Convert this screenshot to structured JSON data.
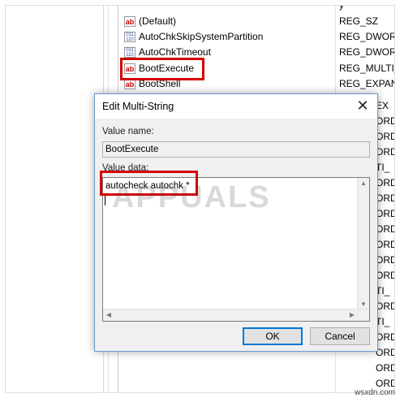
{
  "registry": {
    "header_fragment": "y",
    "rows": [
      {
        "name": "(Default)",
        "type": "REG_SZ",
        "icon": "string-value-icon"
      },
      {
        "name": "AutoChkSkipSystemPartition",
        "type": "REG_DWORD",
        "icon": "binary-value-icon"
      },
      {
        "name": "AutoChkTimeout",
        "type": "REG_DWORD",
        "icon": "binary-value-icon"
      },
      {
        "name": "BootExecute",
        "type": "REG_MULTI_",
        "icon": "string-value-icon"
      },
      {
        "name": "BootShell",
        "type": "REG_EXPANI",
        "icon": "string-value-icon"
      }
    ],
    "type_fragments": [
      "EX",
      "ORD",
      "ORD",
      "ORD",
      "TI_",
      "ORD",
      "ORD",
      "ORD",
      "ORD",
      "ORD",
      "ORD",
      "ORD",
      "TI_",
      "ORD",
      "TI_",
      "ORD",
      "ORD",
      "ORD",
      "ORD",
      "ORD"
    ]
  },
  "dialog": {
    "title": "Edit Multi-String",
    "value_name_label": "Value name:",
    "value_name": "BootExecute",
    "value_data_label": "Value data:",
    "value_data": "autocheck autochk *",
    "ok_label": "OK",
    "cancel_label": "Cancel",
    "close_glyph": "✕"
  },
  "watermark": {
    "logo_text": "APPUALS",
    "site": "wsxdn.com"
  },
  "colors": {
    "highlight": "#d40000",
    "default_button_border": "#0078d7",
    "dialog_border": "#6a9acd"
  }
}
